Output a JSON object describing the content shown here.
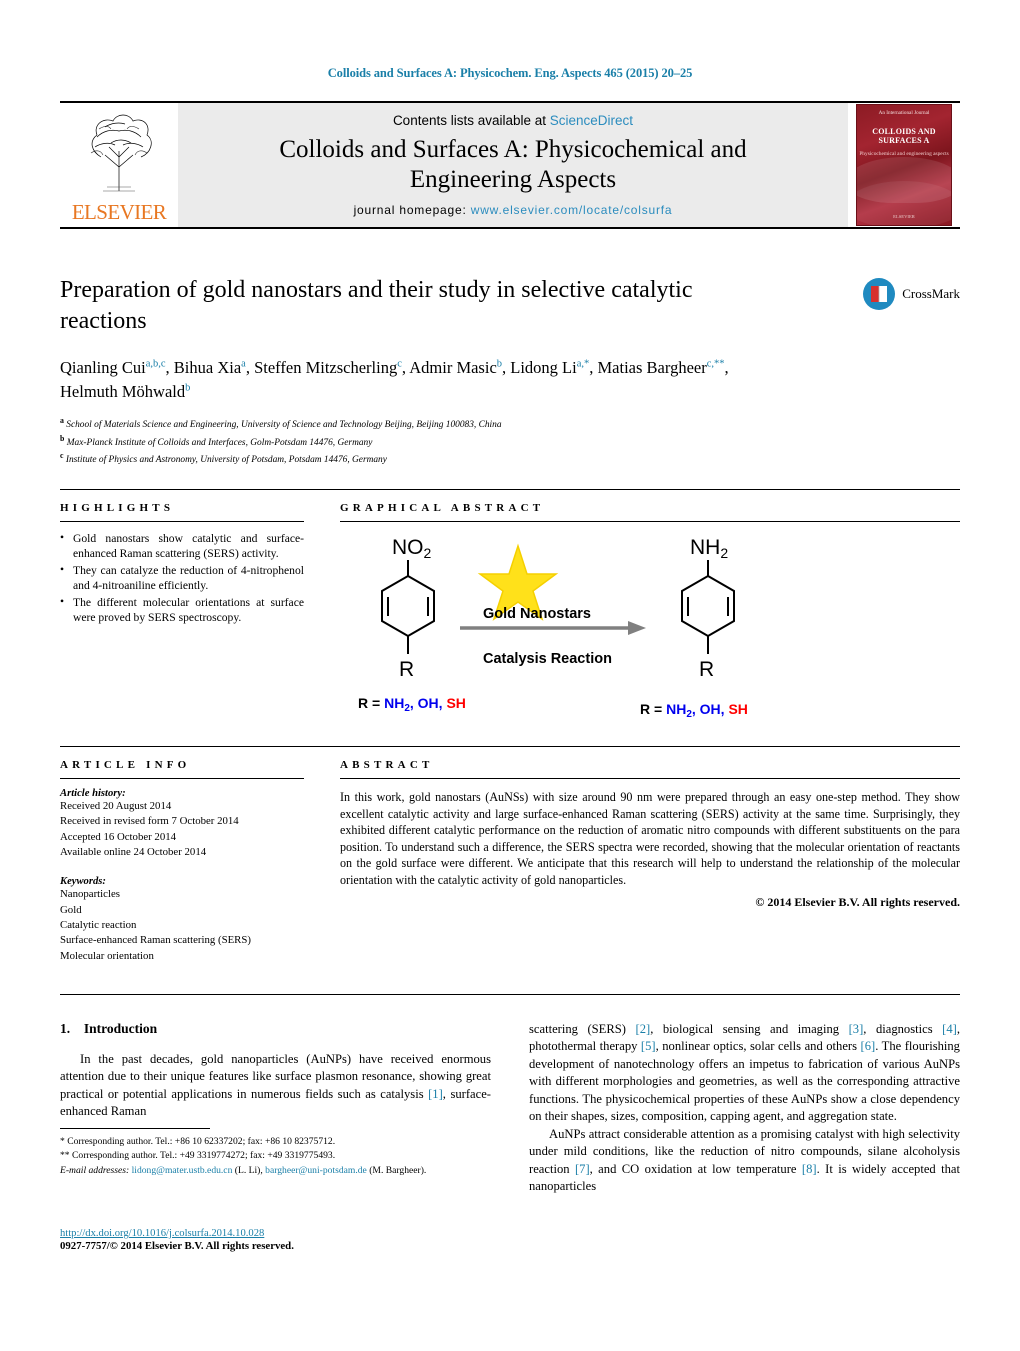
{
  "running_head": "Colloids and Surfaces A: Physicochem. Eng. Aspects 465 (2015) 20–25",
  "masthead": {
    "publisher": "ELSEVIER",
    "contents_prefix": "Contents lists available at ",
    "sciencedirect": "ScienceDirect",
    "journal_title_line1": "Colloids and Surfaces A: Physicochemical and",
    "journal_title_line2": "Engineering Aspects",
    "homepage_prefix": "journal homepage: ",
    "homepage_url": "www.elsevier.com/locate/colsurfa",
    "cover": {
      "top_line": "An International Journal",
      "title": "COLLOIDS AND SURFACES A",
      "subtitle": "Physicochemical and engineering aspects",
      "bottom": "ELSEVIER"
    }
  },
  "crossmark": {
    "label": "CrossMark"
  },
  "article": {
    "title": "Preparation of gold nanostars and their study in selective catalytic reactions",
    "authors": [
      {
        "name": "Qianling Cui",
        "sup": "a,b,c"
      },
      {
        "name": "Bihua Xia",
        "sup": "a"
      },
      {
        "name": "Steffen Mitzscherling",
        "sup": "c"
      },
      {
        "name": "Admir Masic",
        "sup": "b"
      },
      {
        "name": "Lidong Li",
        "sup": "a,*"
      },
      {
        "name": "Matias Bargheer",
        "sup": "c,**"
      },
      {
        "name": "Helmuth Möhwald",
        "sup": "b"
      }
    ],
    "affiliations": [
      {
        "marker": "a",
        "text": "School of Materials Science and Engineering, University of Science and Technology Beijing, Beijing 100083, China"
      },
      {
        "marker": "b",
        "text": "Max-Planck Institute of Colloids and Interfaces, Golm-Potsdam 14476, Germany"
      },
      {
        "marker": "c",
        "text": "Institute of Physics and Astronomy, University of Potsdam, Potsdam 14476, Germany"
      }
    ]
  },
  "highlights": {
    "heading": "HIGHLIGHTS",
    "items": [
      "Gold nanostars show catalytic and surface-enhanced Raman scattering (SERS) activity.",
      "They can catalyze the reduction of 4-nitrophenol and 4-nitroaniline efficiently.",
      "The different molecular orientations at surface were proved by SERS spectroscopy."
    ]
  },
  "graphical_abstract": {
    "heading": "GRAPHICAL ABSTRACT",
    "reactant_top": "NO",
    "reactant_top_sub": "2",
    "product_top": "NH",
    "product_top_sub": "2",
    "reactant_bottom": "R",
    "product_bottom": "R",
    "arrow_label_top": "Gold  Nanostars",
    "arrow_label_bottom": "Catalysis Reaction",
    "legend_prefix": "R = ",
    "legend_blue": "NH2, OH,",
    "legend_blue_main": "NH",
    "legend_blue_sub": "2",
    "legend_blue_rest": ", OH,",
    "legend_red": "SH",
    "colors": {
      "star": "#FFE11A",
      "blue": "#0000EE",
      "red": "#FF0000"
    }
  },
  "article_info": {
    "heading": "ARTICLE INFO",
    "history_label": "Article history:",
    "history": [
      "Received 20 August 2014",
      "Received in revised form 7 October 2014",
      "Accepted 16 October 2014",
      "Available online 24 October 2014"
    ],
    "keywords_label": "Keywords:",
    "keywords": [
      "Nanoparticles",
      "Gold",
      "Catalytic reaction",
      "Surface-enhanced Raman scattering (SERS)",
      "Molecular orientation"
    ]
  },
  "abstract": {
    "heading": "ABSTRACT",
    "text": "In this work, gold nanostars (AuNSs) with size around 90 nm were prepared through an easy one-step method. They show excellent catalytic activity and large surface-enhanced Raman scattering (SERS) activity at the same time. Surprisingly, they exhibited different catalytic performance on the reduction of aromatic nitro compounds with different substituents on the para position. To understand such a difference, the SERS spectra were recorded, showing that the molecular orientation of reactants on the gold surface were different. We anticipate that this research will help to understand the relationship of the molecular orientation with the catalytic activity of gold nanoparticles.",
    "copyright": "© 2014 Elsevier B.V. All rights reserved."
  },
  "introduction": {
    "section_number": "1.",
    "section_title": "Introduction",
    "left_para_1_a": "In the past decades, gold nanoparticles (AuNPs) have received enormous attention due to their unique features like surface plasmon resonance, showing great practical or potential applications in numerous fields such as catalysis ",
    "left_cite_1": "[1]",
    "left_para_1_b": ", surface-enhanced Raman",
    "right_para_1_a": "scattering (SERS) ",
    "right_cite_2": "[2]",
    "right_para_1_b": ", biological sensing and imaging ",
    "right_cite_3": "[3]",
    "right_para_1_c": ", diagnostics ",
    "right_cite_4": "[4]",
    "right_para_1_d": ", photothermal therapy ",
    "right_cite_5": "[5]",
    "right_para_1_e": ", nonlinear optics, solar cells and others ",
    "right_cite_6": "[6]",
    "right_para_1_f": ". The flourishing development of nanotechnology offers an impetus to fabrication of various AuNPs with different morphologies and geometries, as well as the corresponding attractive functions. The physicochemical properties of these AuNPs show a close dependency on their shapes, sizes, composition, capping agent, and aggregation state.",
    "right_para_2_a": "AuNPs attract considerable attention as a promising catalyst with high selectivity under mild conditions, like the reduction of nitro compounds, silane alcoholysis reaction ",
    "right_cite_7": "[7]",
    "right_para_2_b": ", and CO oxidation at low temperature ",
    "right_cite_8": "[8]",
    "right_para_2_c": ". It is widely accepted that nanoparticles"
  },
  "footnotes": {
    "line1": "* Corresponding author. Tel.: +86 10 62337202; fax: +86 10 82375712.",
    "line2": "** Corresponding author. Tel.: +49 3319774272; fax: +49 3319775493.",
    "email_label": "E-mail addresses:",
    "email1": "lidong@mater.ustb.edu.cn",
    "email1_owner": "(L. Li),",
    "email2": "bargheer@uni-potsdam.de",
    "email2_owner": "(M. Bargheer)."
  },
  "footer": {
    "doi": "http://dx.doi.org/10.1016/j.colsurfa.2014.10.028",
    "issn": "0927-7757/© 2014 Elsevier B.V. All rights reserved."
  }
}
